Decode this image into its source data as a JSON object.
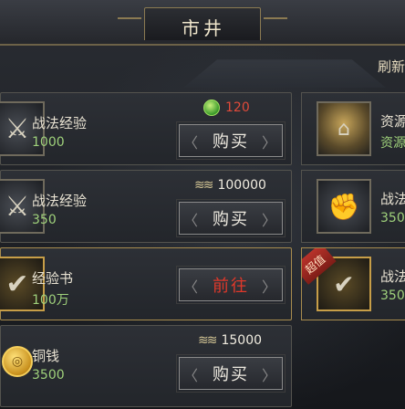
{
  "header": {
    "title": "市井",
    "refresh_label": "刷新"
  },
  "items": [
    {
      "name": "战法经验",
      "qty": "1000",
      "icon": "tactic-scroll-icon",
      "currency_icon": "jade-icon",
      "price": "120",
      "action": "购买"
    },
    {
      "name": "战法经验",
      "qty": "350",
      "icon": "tactic-scroll-icon",
      "currency_icon": "money-icon",
      "price": "100000",
      "action": "购买"
    },
    {
      "name": "经验书",
      "qty": "100万",
      "icon": "experience-book-icon",
      "currency_icon": "",
      "price": "",
      "action": "前往"
    },
    {
      "name": "铜钱",
      "qty": "3500",
      "icon": "copper-coin-icon",
      "currency_icon": "money-icon",
      "price": "15000",
      "action": "购买"
    }
  ],
  "right_items": [
    {
      "name": "资源",
      "sub": "资源",
      "icon": "resource-hut-icon"
    },
    {
      "name": "战法",
      "sub": "350",
      "icon": "tactic-emblem-icon"
    },
    {
      "name": "战法",
      "sub": "350",
      "icon": "tactic-check-icon",
      "ribbon": "超值"
    }
  ],
  "colors": {
    "accent_gold": "#a88c4e",
    "qty_green": "#9fd17b",
    "price_red": "#e04a3a",
    "goto_red": "#e0382a"
  }
}
